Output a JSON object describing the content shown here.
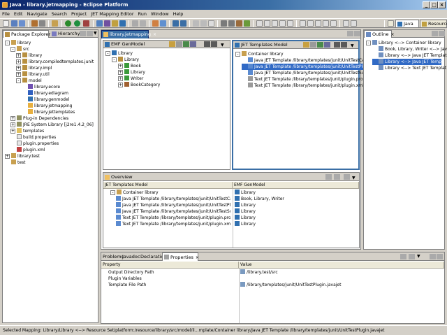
{
  "window": {
    "title": "Java - library.jetmapping - Eclipse Platform",
    "min": "_",
    "max": "□",
    "close": "×"
  },
  "menu": [
    "File",
    "Edit",
    "Navigate",
    "Search",
    "Project",
    "JET Mapping Editor",
    "Run",
    "Window",
    "Help"
  ],
  "perspectives": {
    "java": "Java",
    "resource": "Resource"
  },
  "package_explorer": {
    "tabs": [
      "Package Explorer",
      "Hierarchy"
    ],
    "tree": [
      {
        "label": "library",
        "depth": 0,
        "exp": "-",
        "icon": "project-icon"
      },
      {
        "label": "src",
        "depth": 1,
        "exp": "-",
        "icon": "source-folder-icon"
      },
      {
        "label": "library",
        "depth": 2,
        "exp": "+",
        "icon": "package-icon"
      },
      {
        "label": "library.compiledtemplates.junit",
        "depth": 2,
        "exp": "+",
        "icon": "package-icon"
      },
      {
        "label": "library.impl",
        "depth": 2,
        "exp": "+",
        "icon": "package-icon"
      },
      {
        "label": "library.util",
        "depth": 2,
        "exp": "+",
        "icon": "package-icon"
      },
      {
        "label": "model",
        "depth": 2,
        "exp": "-",
        "icon": "package-icon"
      },
      {
        "label": "library.ecore",
        "depth": 3,
        "exp": "",
        "icon": "ecore-file-icon"
      },
      {
        "label": "library.ediagram",
        "depth": 3,
        "exp": "",
        "icon": "diagram-file-icon"
      },
      {
        "label": "library.genmodel",
        "depth": 3,
        "exp": "",
        "icon": "genmodel-file-icon"
      },
      {
        "label": "library.jetmapping",
        "depth": 3,
        "exp": "",
        "icon": "jetmapping-file-icon"
      },
      {
        "label": "library.jettemplates",
        "depth": 3,
        "exp": "",
        "icon": "jettemplates-file-icon"
      },
      {
        "label": "Plug-in Dependencies",
        "depth": 1,
        "exp": "+",
        "icon": "library-icon"
      },
      {
        "label": "JRE System Library [j2re1.4.2_06]",
        "depth": 1,
        "exp": "+",
        "icon": "library-icon"
      },
      {
        "label": "templates",
        "depth": 1,
        "exp": "+",
        "icon": "folder-icon"
      },
      {
        "label": "build.properties",
        "depth": 1,
        "exp": "",
        "icon": "file-icon"
      },
      {
        "label": "plugin.properties",
        "depth": 1,
        "exp": "",
        "icon": "file-icon"
      },
      {
        "label": "plugin.xml",
        "depth": 1,
        "exp": "",
        "icon": "xml-file-icon"
      },
      {
        "label": "library.test",
        "depth": 0,
        "exp": "+",
        "icon": "project-icon"
      },
      {
        "label": "test",
        "depth": 0,
        "exp": "",
        "icon": "project-icon"
      }
    ]
  },
  "editor": {
    "tab": "library.jetmapping",
    "genmodel": {
      "title": "EMF GenModel",
      "tree": [
        {
          "label": "Library",
          "depth": 0,
          "exp": "-",
          "icon": "genmodel-icon"
        },
        {
          "label": "Library",
          "depth": 1,
          "exp": "-",
          "icon": "package-icon",
          "selected": false
        },
        {
          "label": "Book",
          "depth": 2,
          "exp": "+",
          "icon": "class-icon"
        },
        {
          "label": "Library",
          "depth": 2,
          "exp": "+",
          "icon": "class-icon"
        },
        {
          "label": "Writer",
          "depth": 2,
          "exp": "+",
          "icon": "class-icon"
        },
        {
          "label": "BookCategory",
          "depth": 2,
          "exp": "+",
          "icon": "enum-icon"
        }
      ]
    },
    "templates": {
      "title": "JET Templates Model",
      "tree": [
        {
          "label": "Container library",
          "depth": 0,
          "exp": "-",
          "icon": "container-icon",
          "selected": false
        },
        {
          "label": "Java JET Template /library/templates/junit/UnitTestCas...",
          "depth": 1,
          "exp": "",
          "icon": "java-template-icon",
          "selected": false
        },
        {
          "label": "Java JET Template /library/templates/junit/UnitTestPlugi",
          "depth": 1,
          "exp": "",
          "icon": "java-template-icon",
          "selected": true
        },
        {
          "label": "Java JET Template /library/templates/junit/UnitTestSuit...",
          "depth": 1,
          "exp": "",
          "icon": "java-template-icon",
          "selected": false
        },
        {
          "label": "Text JET Template /library/templates/junit/plugin.prope...",
          "depth": 1,
          "exp": "",
          "icon": "text-template-icon",
          "selected": false
        },
        {
          "label": "Text JET Template /library/templates/junit/plugin.xml.jet",
          "depth": 1,
          "exp": "",
          "icon": "text-template-icon",
          "selected": false
        }
      ]
    },
    "overview": {
      "title": "Overview",
      "columns": [
        "JET Templates Model",
        "EMF GenModel"
      ],
      "rows": [
        {
          "left": "Container library",
          "left_indent": 1,
          "left_exp": "-",
          "right": "Library"
        },
        {
          "left": "Java JET Template /library/templates/junit/UnitTestCas...",
          "left_indent": 2,
          "left_exp": "",
          "right": "Book, Library, Writer"
        },
        {
          "left": "Java JET Template /library/templates/junit/UnitTestPlug...",
          "left_indent": 2,
          "left_exp": "",
          "right": "Library"
        },
        {
          "left": "Java JET Template /library/templates/junit/UnitTestSuit...",
          "left_indent": 2,
          "left_exp": "",
          "right": "Library"
        },
        {
          "left": "Text JET Template /library/templates/junit/plugin.prope...",
          "left_indent": 2,
          "left_exp": "",
          "right": "Library"
        },
        {
          "left": "Text JET Template /library/templates/junit/plugin.xml.jet",
          "left_indent": 2,
          "left_exp": "",
          "right": "Library"
        }
      ]
    }
  },
  "outline": {
    "tab": "Outline",
    "tree": [
      {
        "label": "Library <--> Container library",
        "depth": 0,
        "exp": "-",
        "selected": false
      },
      {
        "label": "Book, Library, Writer <--> Java JE",
        "depth": 1,
        "exp": "",
        "selected": false
      },
      {
        "label": "Library <--> Java JET Template",
        "depth": 1,
        "exp": "",
        "selected": false
      },
      {
        "label": "Library <--> Java JET Temp",
        "depth": 1,
        "exp": "",
        "selected": true
      },
      {
        "label": "Library <--> Text JET Templat",
        "depth": 1,
        "exp": "",
        "selected": false
      }
    ]
  },
  "properties": {
    "tabs": [
      "Problems",
      "Javadoc",
      "Declaration",
      "Properties"
    ],
    "columns": [
      "Property",
      "Value"
    ],
    "rows": [
      {
        "property": "Output Directory Path",
        "value": "/library.test/src"
      },
      {
        "property": "Plugin Variables",
        "value": ""
      },
      {
        "property": "Template File Path",
        "value": "/library/templates/junit/UnitTestPlugin.javajet"
      }
    ]
  },
  "status": "Selected Mapping: Library/Library <--> Resource Set/platform:/resource/library/src/model/li...mplate/Container library/Java JET Template /library/templates/junit/UnitTestPlugin.javajet",
  "colors": {
    "selection": "#316ac5",
    "title_start": "#0a246a",
    "title_end": "#a6caf0",
    "chrome": "#d4d0c8"
  }
}
